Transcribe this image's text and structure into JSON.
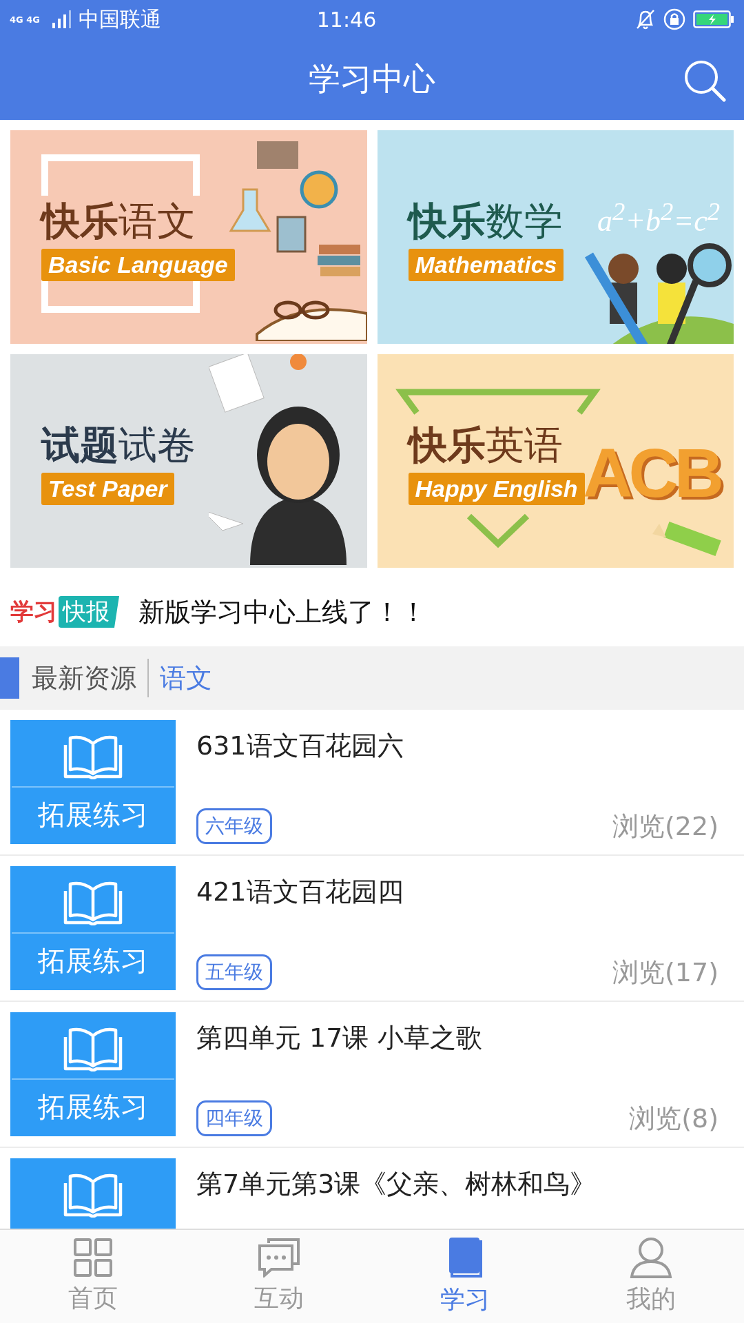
{
  "status_bar": {
    "network": "4G 4G",
    "carrier": "中国联通",
    "time": "11:46"
  },
  "header": {
    "title": "学习中心"
  },
  "banners": [
    {
      "kind": "language",
      "title": "**快乐**语文",
      "subtitle": "Basic Language"
    },
    {
      "kind": "math",
      "title": "**快乐**数学",
      "subtitle": "Mathematics",
      "formula": "a$^{2}$+b$^{2}$=c$^{2}$"
    },
    {
      "kind": "test",
      "title": "**试题**试卷",
      "subtitle": "Test Paper"
    },
    {
      "kind": "english",
      "title": "**快乐**英语",
      "subtitle": "Happy English",
      "letters": "ACB"
    }
  ],
  "news": {
    "badge_left": "学习",
    "badge_right": "快报",
    "text": "新版学习中心上线了！！"
  },
  "section": {
    "title": "最新资源",
    "subject": "语文"
  },
  "resources": [
    {
      "label": "拓展练习",
      "title": "631语文百花园六",
      "grade": "六年级",
      "views": "浏览(22)"
    },
    {
      "label": "拓展练习",
      "title": "421语文百花园四",
      "grade": "五年级",
      "views": "浏览(17)"
    },
    {
      "label": "拓展练习",
      "title": "第四单元 17课 小草之歌",
      "grade": "四年级",
      "views": "浏览(8)"
    },
    {
      "title": "第7单元第3课《父亲、树林和鸟》"
    }
  ],
  "tab_bar": [
    {
      "kind": "home",
      "label": "首页",
      "selected": false
    },
    {
      "kind": "chat",
      "label": "互动",
      "selected": false
    },
    {
      "kind": "study",
      "label": "学习",
      "selected": true
    },
    {
      "kind": "profile",
      "label": "我的",
      "selected": false
    }
  ]
}
